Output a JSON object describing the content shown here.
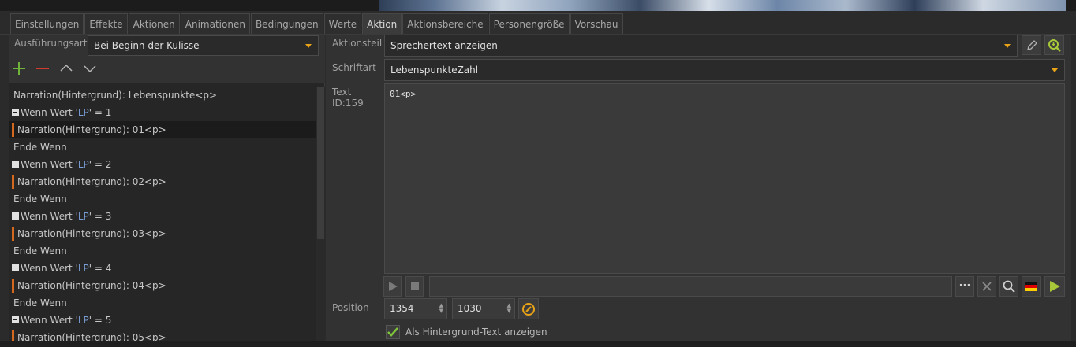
{
  "tabs": [
    "Einstellungen",
    "Effekte",
    "Aktionen",
    "Animationen",
    "Bedingungen",
    "Werte",
    "Aktion",
    "Aktionsbereiche",
    "Personengröße",
    "Vorschau"
  ],
  "active_tab": "Aktion",
  "left": {
    "execution_label": "Ausführungsart",
    "execution_value": "Bei Beginn der Kulisse",
    "tree": [
      {
        "text": "Narration(Hintergrund): Lebenspunkte<p>"
      },
      {
        "prefix": "Wenn Wert '",
        "var": "LP",
        "suffix": "' = 1"
      },
      {
        "text": "Narration(Hintergrund): 01<p>"
      },
      {
        "text": "Ende Wenn"
      },
      {
        "prefix": "Wenn Wert '",
        "var": "LP",
        "suffix": "' = 2"
      },
      {
        "text": "Narration(Hintergrund): 02<p>"
      },
      {
        "text": "Ende Wenn"
      },
      {
        "prefix": "Wenn Wert '",
        "var": "LP",
        "suffix": "' = 3"
      },
      {
        "text": "Narration(Hintergrund): 03<p>"
      },
      {
        "text": "Ende Wenn"
      },
      {
        "prefix": "Wenn Wert '",
        "var": "LP",
        "suffix": "' = 4"
      },
      {
        "text": "Narration(Hintergrund): 04<p>"
      },
      {
        "text": "Ende Wenn"
      },
      {
        "prefix": "Wenn Wert '",
        "var": "LP",
        "suffix": "' = 5"
      },
      {
        "text": "Narration(Hintergrund): 05<p>"
      }
    ]
  },
  "right": {
    "action_part_label": "Aktionsteil",
    "action_part_value": "Sprechertext anzeigen",
    "font_label": "Schriftart",
    "font_value": "LebenspunkteZahl",
    "text_label": "Text",
    "text_id": "ID:159",
    "text_value": "01<p>",
    "position_label": "Position",
    "position_x": "1354",
    "position_y": "1030",
    "background_checkbox_label": "Als Hintergrund-Text anzeigen",
    "more_label": "···"
  },
  "colors": {
    "accent": "#e8a317",
    "add": "#6fb33a",
    "remove": "#d23b2b",
    "action_bar": "#d2691e",
    "variable": "#7a9fd8"
  },
  "icons": {
    "edit": "pencil-icon",
    "zoom": "zoom-in-icon",
    "play": "play-icon",
    "stop": "stop-icon",
    "clear": "close-icon",
    "search": "search-icon",
    "language": "german-flag-icon",
    "run": "run-icon",
    "target": "target-icon"
  }
}
